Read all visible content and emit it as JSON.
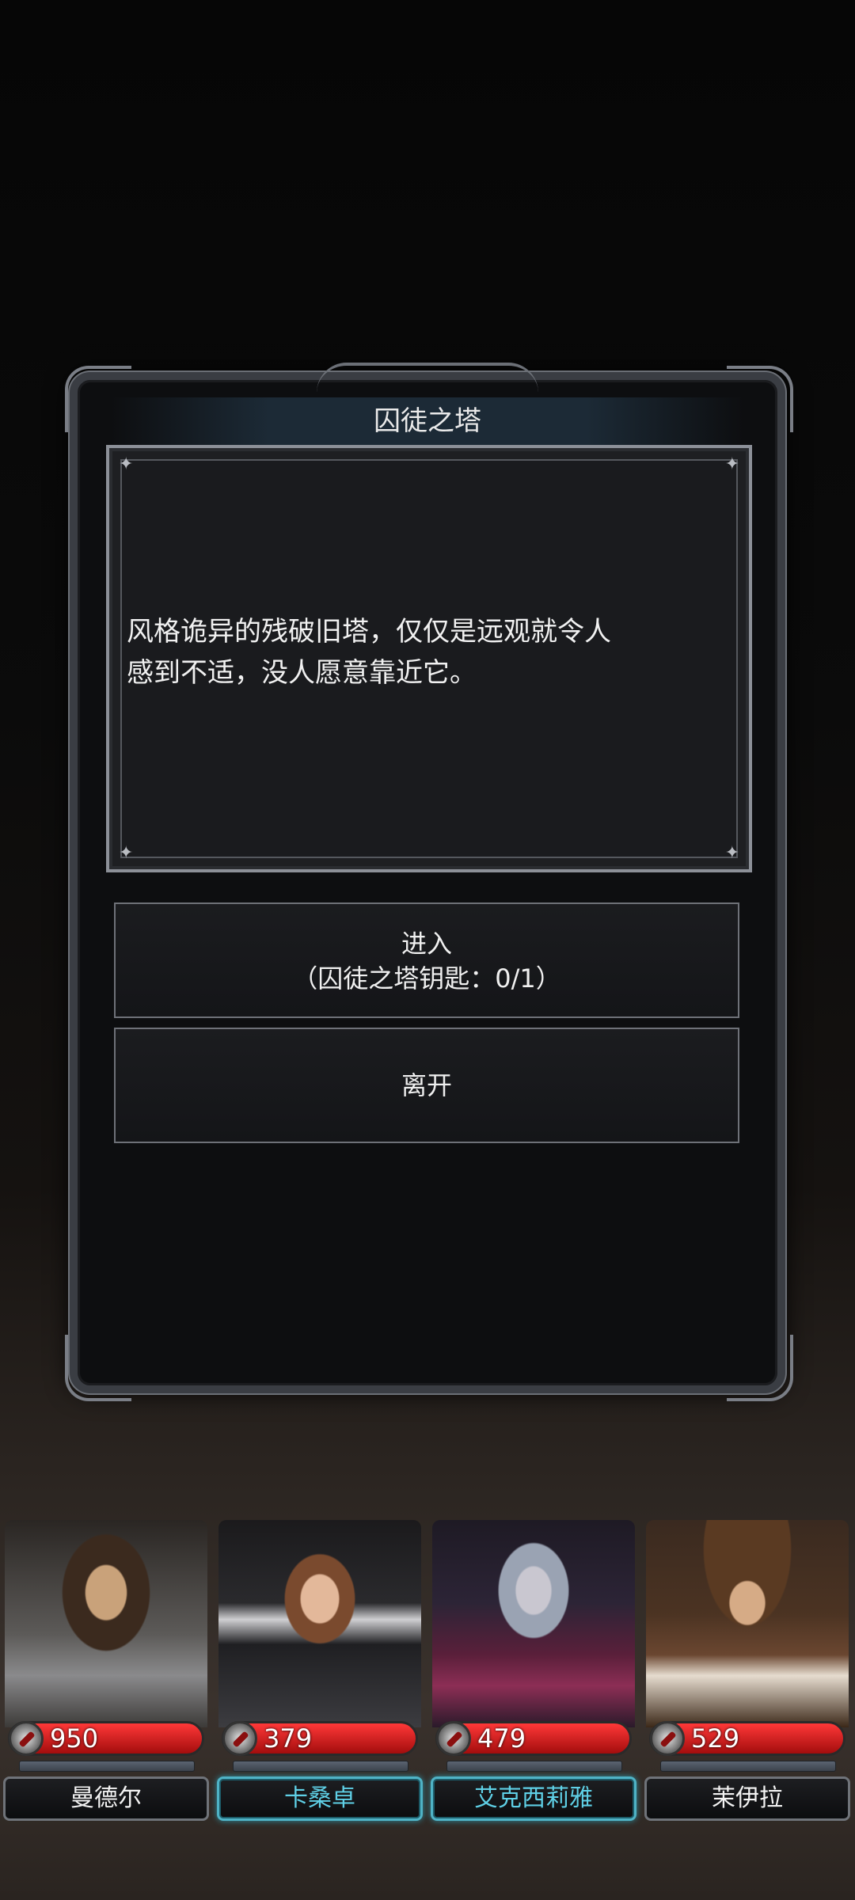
{
  "dialog": {
    "title": "囚徒之塔",
    "description_line1": "风格诡异的残破旧塔，仅仅是远观就令人",
    "description_line2": "感到不适，没人愿意靠近它。",
    "enter_button_line1": "进入",
    "enter_button_line2": "（囚徒之塔钥匙：0/1）",
    "leave_button": "离开"
  },
  "party": [
    {
      "name": "曼德尔",
      "hp": "950",
      "selected": false,
      "accent": "#6f7379"
    },
    {
      "name": "卡桑卓",
      "hp": "379",
      "selected": true,
      "accent": "#4fb3c6"
    },
    {
      "name": "艾克西莉雅",
      "hp": "479",
      "selected": true,
      "accent": "#4fb3c6"
    },
    {
      "name": "茉伊拉",
      "hp": "529",
      "selected": false,
      "accent": "#6f7379"
    }
  ]
}
